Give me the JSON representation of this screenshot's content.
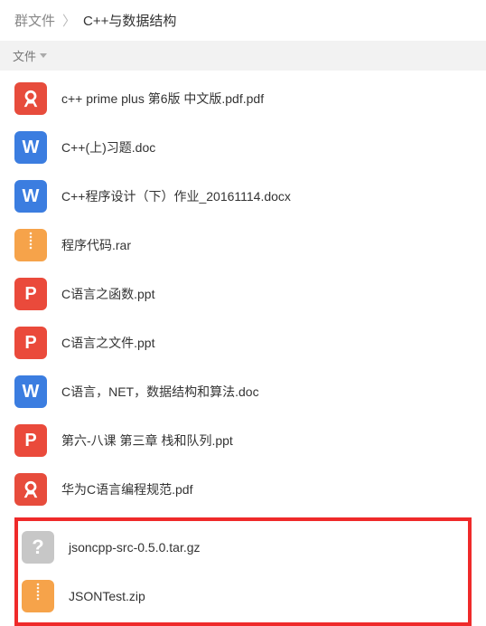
{
  "breadcrumb": {
    "root": "群文件",
    "current": "C++与数据结构"
  },
  "column": {
    "file_label": "文件"
  },
  "files": [
    {
      "name": "c++ prime plus 第6版 中文版.pdf.pdf",
      "type": "pdf"
    },
    {
      "name": "C++(上)习题.doc",
      "type": "doc"
    },
    {
      "name": "C++程序设计（下）作业_20161114.docx",
      "type": "doc"
    },
    {
      "name": "程序代码.rar",
      "type": "zip"
    },
    {
      "name": "C语言之函数.ppt",
      "type": "ppt"
    },
    {
      "name": "C语言之文件.ppt",
      "type": "ppt"
    },
    {
      "name": "C语言，NET，数据结构和算法.doc",
      "type": "doc"
    },
    {
      "name": "第六-八课 第三章 栈和队列.ppt",
      "type": "ppt"
    },
    {
      "name": "华为C语言编程规范.pdf",
      "type": "pdf"
    }
  ],
  "highlighted_files": [
    {
      "name": "jsoncpp-src-0.5.0.tar.gz",
      "type": "unknown"
    },
    {
      "name": "JSONTest.zip",
      "type": "zip"
    }
  ]
}
